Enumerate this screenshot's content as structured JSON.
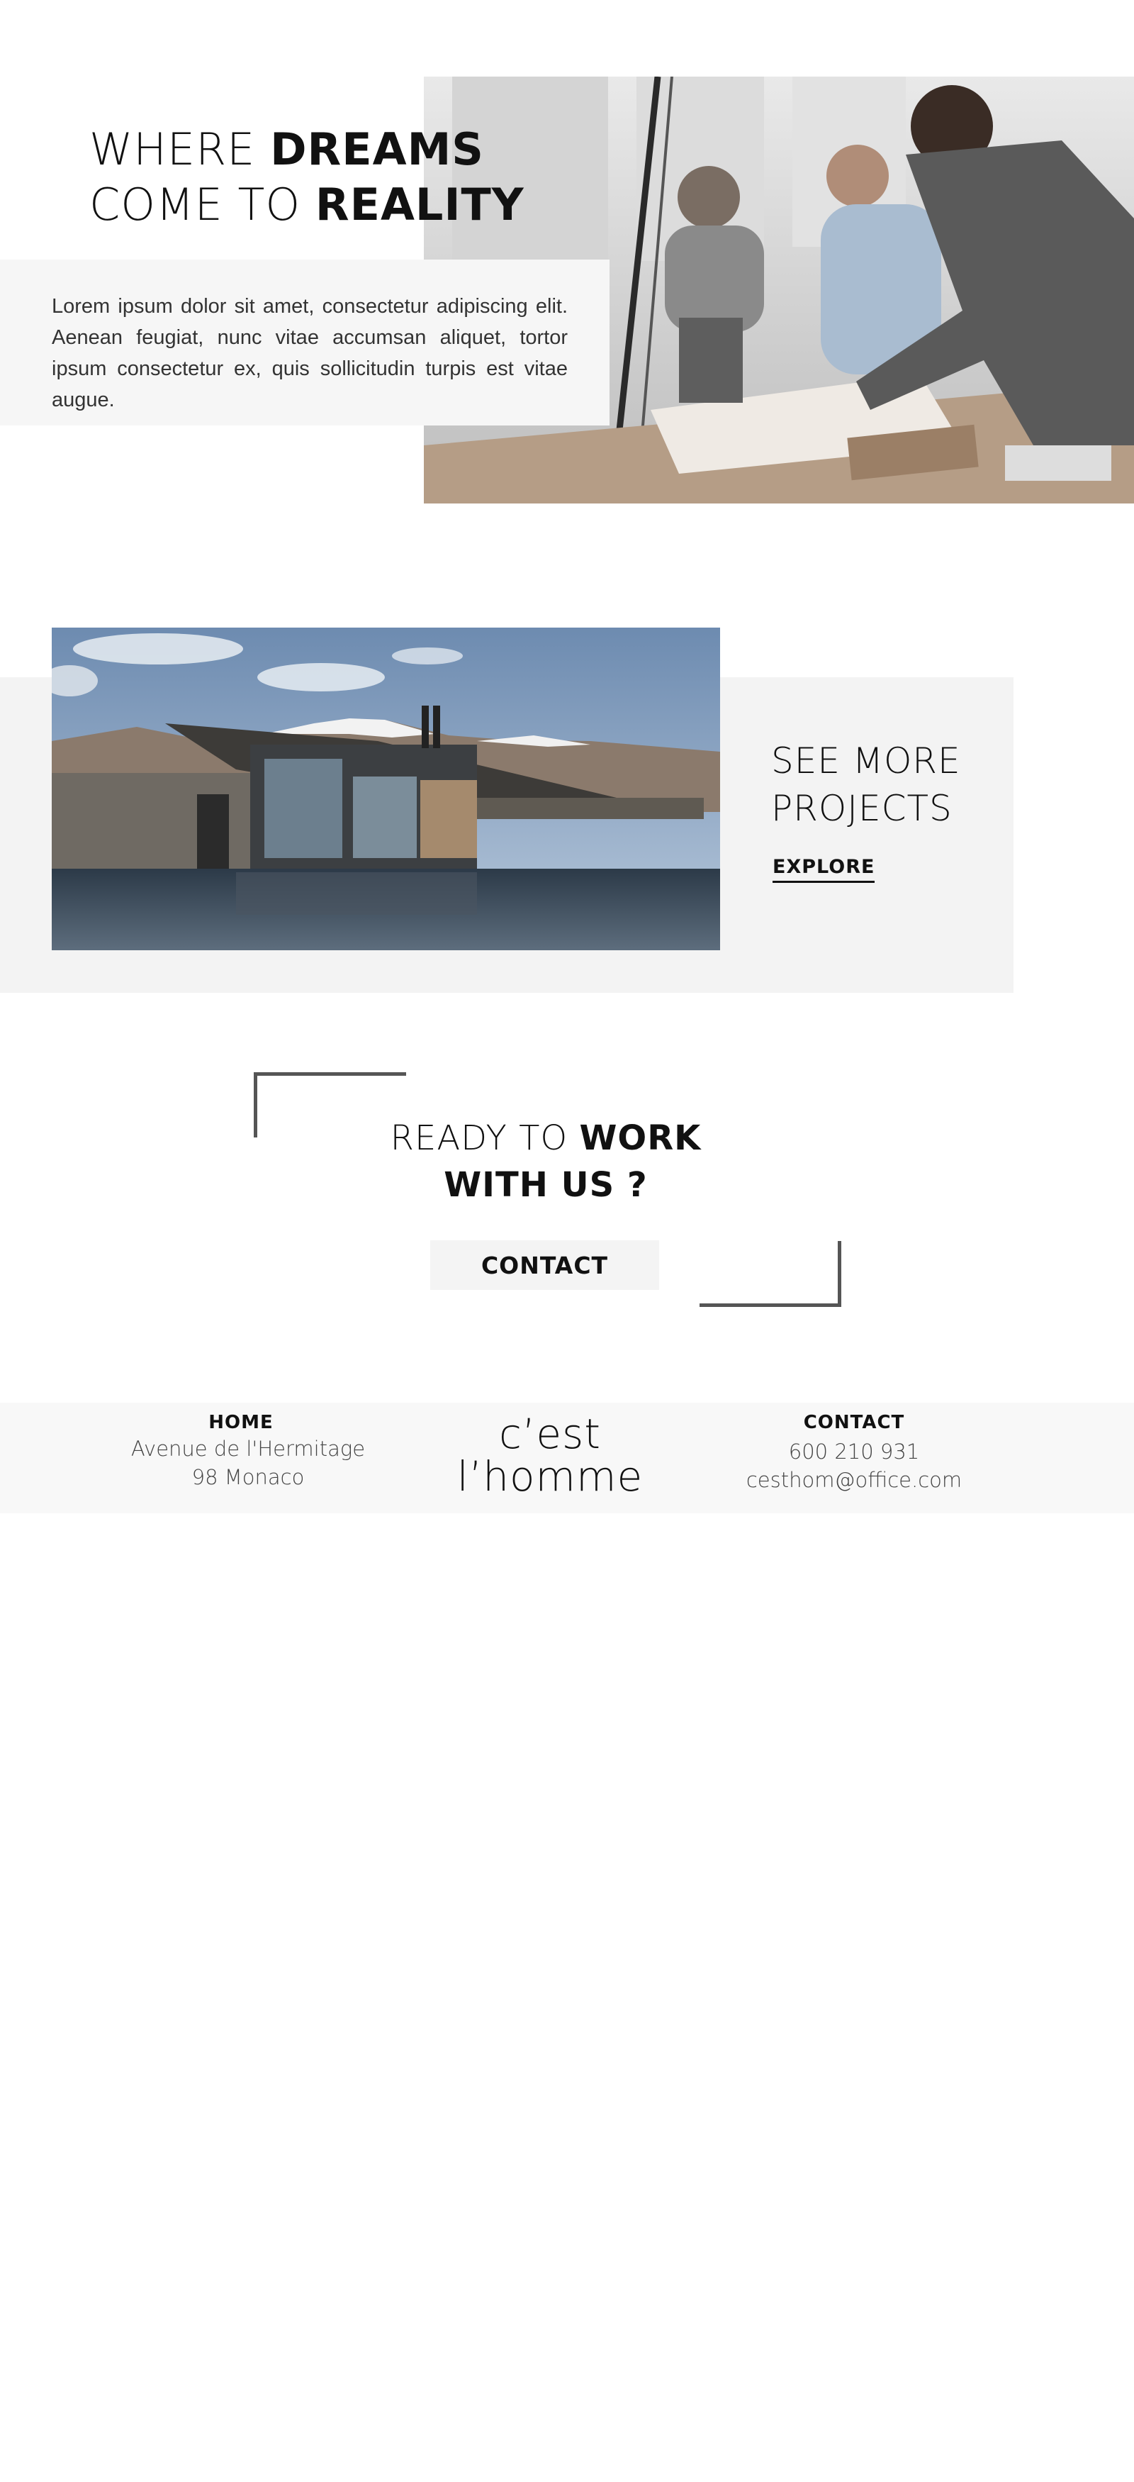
{
  "hero": {
    "title_line1_thin": "WHERE ",
    "title_line1_bold": "DREAMS",
    "title_line2_thin": "COME TO ",
    "title_line2_bold": "REALITY",
    "text": "Lorem ipsum dolor sit amet, consectetur adipiscing elit. Aenean feugiat, nunc vitae accumsan aliquet, tortor ipsum consectetur ex, quis sollicitudin turpis est vitae augue."
  },
  "projects": {
    "title_line1": "SEE MORE",
    "title_line2": "PROJECTS",
    "link_label": "EXPLORE"
  },
  "cta": {
    "line1_thin": "READY TO ",
    "line1_bold": "WORK",
    "line2_bold": "WITH US ?",
    "button_label": "CONTACT"
  },
  "footer": {
    "left": {
      "heading": "HOME",
      "address_line1": "Avenue de l'Hermitage",
      "address_line2": "98 Monaco"
    },
    "logo": {
      "line1": "c’est",
      "line2": "l’homme"
    },
    "right": {
      "heading": "CONTACT",
      "phone": "600 210 931",
      "email": "cesthom@office.com"
    }
  },
  "colors": {
    "text": "#111111",
    "light_panel": "#f3f3f3",
    "footer_bg": "#f8f8f8",
    "bracket": "#555555"
  }
}
